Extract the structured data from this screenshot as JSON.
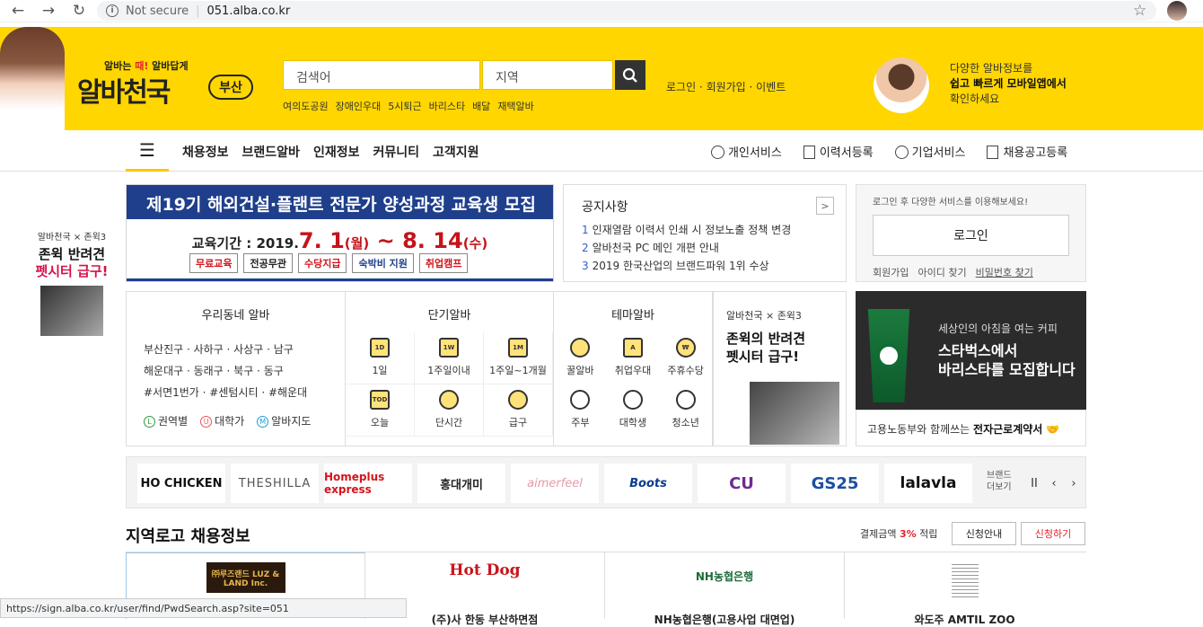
{
  "browser": {
    "security": "Not secure",
    "url": "051.alba.co.kr"
  },
  "header": {
    "slogan_pre": "알바는 ",
    "slogan_red": "때!",
    "slogan_post": " 알바답게",
    "logo": "알바천국",
    "region": "부산",
    "search_placeholder": "검색어",
    "area_placeholder": "지역",
    "keywords": [
      "여의도공원",
      "장애인우대",
      "5시퇴근",
      "바리스타",
      "배달",
      "재택알바"
    ],
    "account_links": "로그인 · 회원가입 · 이벤트",
    "app_promo": {
      "line1": "다양한 알바정보를",
      "line2": "쉽고 빠르게 모바일앱에서",
      "line3": "확인하세요"
    }
  },
  "nav": {
    "menu": [
      "채용정보",
      "브랜드알바",
      "인재정보",
      "커뮤니티",
      "고객지원"
    ],
    "right": [
      "개인서비스",
      "이력서등록",
      "기업서비스",
      "채용공고등록"
    ]
  },
  "side_promo": {
    "sub": "알바천국 × 존윅3",
    "line1": "존윅 반려견",
    "line2": "펫시터 급구!"
  },
  "banner": {
    "title": "제19기 해외건설·플랜트 전문가 양성과정 교육생 모집",
    "period_label": "교육기간 :  2019.",
    "d1": "7. 1",
    "w1": "(월)",
    "tilde": " ~ ",
    "d2": "8. 14",
    "w2": "(수)",
    "tags": [
      "무료교육",
      "전공무관",
      "수당지급",
      "숙박비 지원",
      "취업캠프"
    ]
  },
  "notice": {
    "title": "공지사항",
    "more": ">",
    "items": [
      {
        "n": "1",
        "t": "인재열람 이력서 인쇄 시 정보노출 정책 변경"
      },
      {
        "n": "2",
        "t": "알바천국 PC 메인 개편 안내"
      },
      {
        "n": "3",
        "t": "2019 한국산업의 브랜드파워 1위 수상"
      }
    ]
  },
  "login": {
    "message": "로그인 후 다양한 서비스를 이용해보세요!",
    "button": "로그인",
    "links": [
      "회원가입",
      "아이디 찾기",
      "비밀번호 찾기"
    ]
  },
  "local": {
    "title": "우리동네 알바",
    "lines": [
      "부산진구 · 사하구 · 사상구 · 남구",
      "해운대구 · 동래구 · 북구 · 동구",
      "#서면1번가 · #센텀시티 · #해운대"
    ],
    "links": [
      {
        "ic": "L",
        "t": "권역별",
        "c": "#2a9d3a"
      },
      {
        "ic": "U",
        "t": "대학가",
        "c": "#e55"
      },
      {
        "ic": "M",
        "t": "알바지도",
        "c": "#1aa0d9"
      }
    ]
  },
  "short": {
    "title": "단기알바",
    "items": [
      {
        "ic": "1D",
        "t": "1일"
      },
      {
        "ic": "1W",
        "t": "1주일이내"
      },
      {
        "ic": "1M",
        "t": "1주일~1개월"
      },
      {
        "ic": "TOD",
        "t": "오늘"
      },
      {
        "ic": "",
        "t": "단시간"
      },
      {
        "ic": "",
        "t": "급구"
      }
    ]
  },
  "theme": {
    "title": "테마알바",
    "items": [
      {
        "ic": "",
        "t": "꿀알바"
      },
      {
        "ic": "A",
        "t": "취업우대"
      },
      {
        "ic": "₩",
        "t": "주휴수당"
      },
      {
        "ic": "",
        "t": "주부"
      },
      {
        "ic": "",
        "t": "대학생"
      },
      {
        "ic": "",
        "t": "청소년"
      }
    ]
  },
  "promo2": {
    "sub": "알바천국 × 존윅3",
    "line1": "존윅의 반려견",
    "line2": "펫시터 급구!"
  },
  "starbucks": {
    "sub": "세상인의 아침을 여는 커피",
    "line1": "스타벅스에서",
    "line2": "바리스타를 모집합니다"
  },
  "labor": {
    "pre": "고용노동부와 함께쓰는 ",
    "bold": "전자근로계약서"
  },
  "brands": {
    "items": [
      {
        "t": "HO CHICKEN",
        "c": "#111"
      },
      {
        "t": "THESHILLA",
        "c": "#555"
      },
      {
        "t": "Homeplus express",
        "c": "#d4141b"
      },
      {
        "t": "홍대개미",
        "c": "#222"
      },
      {
        "t": "aimerfeel",
        "c": "#e79aaa"
      },
      {
        "t": "Boots",
        "c": "#0b3c8c"
      },
      {
        "t": "CU",
        "c": "#6f2c91"
      },
      {
        "t": "GS25",
        "c": "#1c4fa1"
      },
      {
        "t": "lalavla",
        "c": "#111"
      }
    ],
    "more": [
      "브랜드",
      "더보기"
    ],
    "controls": [
      "II",
      "‹",
      "›"
    ]
  },
  "section": {
    "title": "지역로고 채용정보",
    "fee_pre": "결제금액 ",
    "fee_pct": "3%",
    "fee_post": " 적립",
    "btn1": "신청안내",
    "btn2": "신청하기"
  },
  "cards": [
    {
      "logo": "㈜루즈랜드 LUZ & LAND Inc.",
      "name": ""
    },
    {
      "logo": "Hot Dog",
      "name": "(주)사 한동 부산하면점"
    },
    {
      "logo": "NH농협은행",
      "name": "NH농협은행(고용사업 대면업)"
    },
    {
      "logo": "",
      "name": "와도주 AMTIL ZOO"
    }
  ],
  "status_url": "https://sign.alba.co.kr/user/find/PwdSearch.asp?site=051"
}
